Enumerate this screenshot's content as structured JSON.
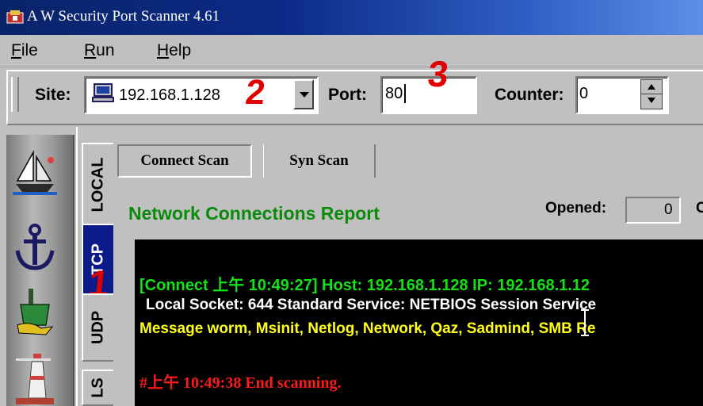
{
  "window": {
    "title": "A W Security Port Scanner 4.61"
  },
  "menu": {
    "items": [
      {
        "label_pre": "",
        "underline": "F",
        "label_post": "ile"
      },
      {
        "label_pre": "",
        "underline": "R",
        "label_post": "un"
      },
      {
        "label_pre": "",
        "underline": "H",
        "label_post": "elp"
      }
    ]
  },
  "toolbar": {
    "site_label": "Site:",
    "site_value": "192.168.1.128",
    "port_label": "Port:",
    "port_value": "80",
    "counter_label": "Counter:",
    "counter_value": "0"
  },
  "annotations": {
    "one": "1",
    "two": "2",
    "three": "3"
  },
  "side_tabs": [
    "LOCAL",
    "TCP",
    "UDP",
    "LS"
  ],
  "scan_tabs": {
    "connect": "Connect Scan",
    "syn": "Syn Scan"
  },
  "report": {
    "title": "Network Connections Report",
    "opened_label": "Opened:",
    "opened_value": "0",
    "opened_trail": "C"
  },
  "console": {
    "lines": [
      "[Connect 上午 10:49:27] Host: 192.168.1.128 IP: 192.168.1.12",
      "Local Socket: 644  Standard Service: NETBIOS Session Service",
      "Message worm, Msinit, Netlog, Network, Qaz, Sadmind, SMB Re",
      "#上午 10:49:38 End scanning."
    ]
  },
  "colors": {
    "console_green": "#16e016",
    "console_yellow": "#ffff18",
    "console_red": "#ff1a1a",
    "report_green": "#0b8a0b"
  }
}
